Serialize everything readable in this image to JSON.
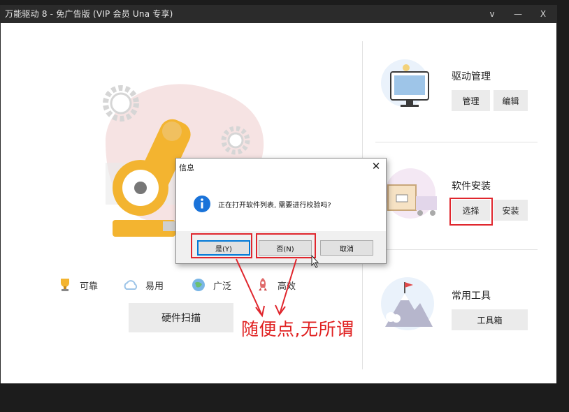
{
  "window": {
    "title": "万能驱动 8  - 免广告版 (VIP 会员 Una 专享)",
    "controls": {
      "collapse": "v",
      "minimize": "—",
      "close": "X"
    }
  },
  "features": [
    {
      "label": "可靠",
      "icon": "trophy-icon"
    },
    {
      "label": "易用",
      "icon": "cloud-icon"
    },
    {
      "label": "广泛",
      "icon": "globe-icon"
    },
    {
      "label": "高效",
      "icon": "rocket-icon"
    }
  ],
  "scan_button": "硬件扫描",
  "sections": {
    "driver": {
      "title": "驱动管理",
      "buttons": [
        "管理",
        "编辑"
      ],
      "icon": "monitor-icon"
    },
    "software": {
      "title": "软件安装",
      "buttons": [
        "选择",
        "安装"
      ],
      "icon": "package-icon"
    },
    "tools": {
      "title": "常用工具",
      "buttons": [
        "工具箱"
      ],
      "icon": "mountain-flag-icon"
    }
  },
  "dialog": {
    "title": "信息",
    "close": "✕",
    "message": "正在打开软件列表, 需要进行校验吗?",
    "icon": "info-icon",
    "buttons": {
      "yes": "是(Y)",
      "no": "否(N)",
      "cancel": "取消"
    }
  },
  "annotation": {
    "text": "随便点,无所谓",
    "color": "#e02020"
  },
  "colors": {
    "accent_blue": "#0078d7",
    "annotation_red": "#e0262d",
    "titlebar": "#2b2b2b"
  }
}
